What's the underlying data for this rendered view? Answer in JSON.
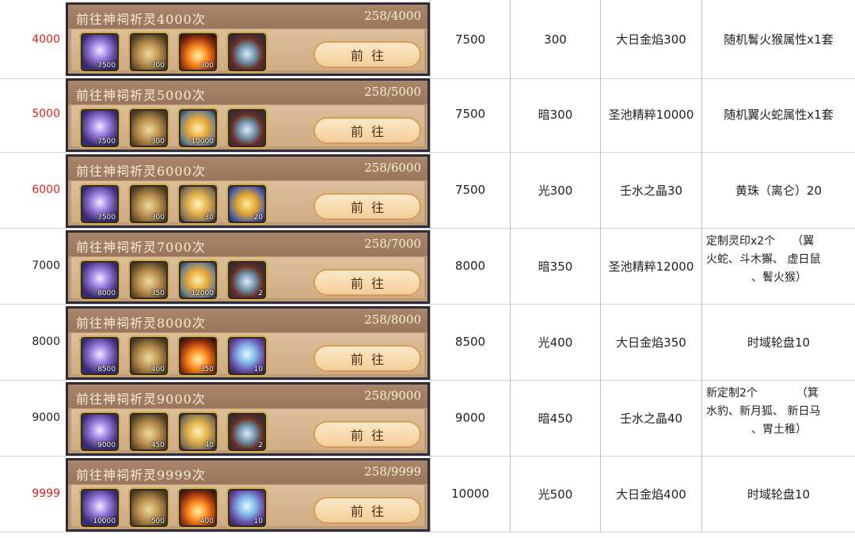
{
  "rows": [
    {
      "level": "4000",
      "red": true,
      "title": "前往神祠祈灵4000次",
      "progress": "258/4000",
      "button": "前往",
      "items": [
        {
          "icon": "crystal-icon",
          "qty": "7500"
        },
        {
          "icon": "bag-icon",
          "qty": "300"
        },
        {
          "icon": "flame-icon",
          "qty": "300"
        },
        {
          "icon": "chest-icon",
          "qty": ""
        }
      ],
      "b": "7500",
      "c": "300",
      "d": "大日金焰300",
      "e": "随机鬌火猴属性x1套"
    },
    {
      "level": "5000",
      "red": true,
      "title": "前往神祠祈灵5000次",
      "progress": "258/5000",
      "button": "前往",
      "items": [
        {
          "icon": "crystal-icon",
          "qty": "7500"
        },
        {
          "icon": "bag-icon",
          "qty": "300"
        },
        {
          "icon": "drop-icon",
          "qty": "10000"
        },
        {
          "icon": "chest-icon",
          "qty": ""
        }
      ],
      "b": "7500",
      "c": "暗300",
      "d": "圣池精粹10000",
      "e": "随机翼火蛇属性x1套"
    },
    {
      "level": "6000",
      "red": true,
      "title": "前往神祠祈灵6000次",
      "progress": "258/6000",
      "button": "前往",
      "items": [
        {
          "icon": "crystal-icon",
          "qty": "7500"
        },
        {
          "icon": "bag-icon",
          "qty": "300"
        },
        {
          "icon": "orb-icon",
          "qty": "30"
        },
        {
          "icon": "gourd-icon",
          "qty": "20"
        }
      ],
      "b": "7500",
      "c": "光300",
      "d": "壬水之晶30",
      "e": "黄珠（离仑）20"
    },
    {
      "level": "7000",
      "red": false,
      "title": "前往神祠祈灵7000次",
      "progress": "258/7000",
      "button": "前往",
      "items": [
        {
          "icon": "crystal-icon",
          "qty": "8000"
        },
        {
          "icon": "bag-icon",
          "qty": "350"
        },
        {
          "icon": "drop-icon",
          "qty": "12000"
        },
        {
          "icon": "chest-icon",
          "qty": "2"
        }
      ],
      "b": "8000",
      "c": "暗350",
      "d": "圣池精粹12000",
      "e_lines": [
        "定制灵印x2个　　（翼",
        "火蛇、斗木獬、 虚日鼠",
        "、鬌火猴）"
      ]
    },
    {
      "level": "8000",
      "red": false,
      "title": "前往神祠祈灵8000次",
      "progress": "258/8000",
      "button": "前往",
      "items": [
        {
          "icon": "crystal-icon",
          "qty": "8500"
        },
        {
          "icon": "bag-icon",
          "qty": "400"
        },
        {
          "icon": "flame-icon",
          "qty": "350"
        },
        {
          "icon": "wheel-icon",
          "qty": "10"
        }
      ],
      "b": "8500",
      "c": "光400",
      "d": "大日金焰350",
      "e": "时域轮盘10"
    },
    {
      "level": "9000",
      "red": false,
      "title": "前往神祠祈灵9000次",
      "progress": "258/9000",
      "button": "前往",
      "items": [
        {
          "icon": "crystal-icon",
          "qty": "9000"
        },
        {
          "icon": "bag-icon",
          "qty": "450"
        },
        {
          "icon": "orb-icon",
          "qty": "40"
        },
        {
          "icon": "chest-icon",
          "qty": "2"
        }
      ],
      "b": "9000",
      "c": "暗450",
      "d": "壬水之晶40",
      "e_lines": [
        "新定制2个　　　　（箕",
        "水豹、新月狐、 新日马",
        "、胃土稚）"
      ]
    },
    {
      "level": "9999",
      "red": true,
      "title": "前往神祠祈灵9999次",
      "progress": "258/9999",
      "button": "前往",
      "items": [
        {
          "icon": "crystal-icon",
          "qty": "10000"
        },
        {
          "icon": "bag-icon",
          "qty": "500"
        },
        {
          "icon": "flame-icon",
          "qty": "400"
        },
        {
          "icon": "wheel-icon",
          "qty": "10"
        }
      ],
      "b": "10000",
      "c": "光500",
      "d": "大日金焰400",
      "e": "时域轮盘10"
    }
  ]
}
